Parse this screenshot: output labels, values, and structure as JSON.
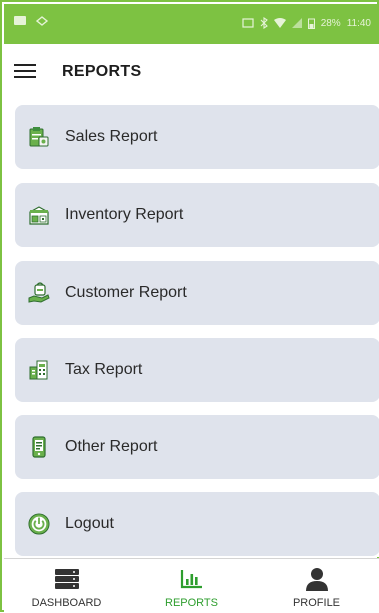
{
  "header": {
    "title": "REPORTS"
  },
  "status_bar": {
    "battery": "28%",
    "time": "11:40"
  },
  "reports": [
    {
      "label": "Sales Report",
      "icon": "sales-report-icon"
    },
    {
      "label": "Inventory Report",
      "icon": "inventory-report-icon"
    },
    {
      "label": "Customer Report",
      "icon": "customer-report-icon"
    },
    {
      "label": "Tax Report",
      "icon": "tax-report-icon"
    },
    {
      "label": "Other Report",
      "icon": "other-report-icon"
    },
    {
      "label": "Logout",
      "icon": "logout-icon"
    }
  ],
  "bottom_nav": [
    {
      "label": "DASHBOARD",
      "icon": "server-icon"
    },
    {
      "label": "REPORTS",
      "icon": "bar-chart-icon",
      "active": true
    },
    {
      "label": "PROFILE",
      "icon": "person-icon"
    }
  ],
  "colors": {
    "accent": "#7dc242",
    "card": "#dfe3ec",
    "active_nav": "#2e9e2e"
  }
}
